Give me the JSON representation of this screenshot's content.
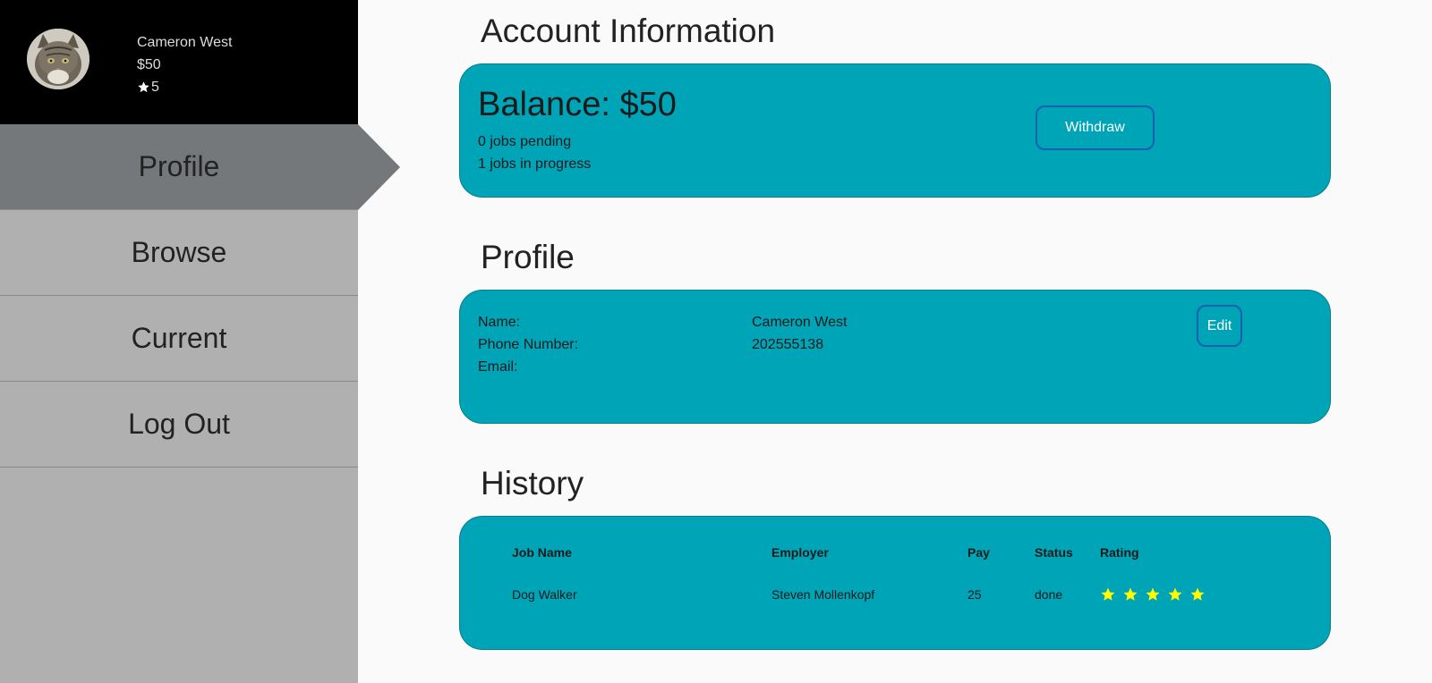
{
  "user": {
    "name": "Cameron West",
    "balance": "$50",
    "rating": "5"
  },
  "nav": {
    "items": [
      {
        "label": "Profile",
        "active": true
      },
      {
        "label": "Browse"
      },
      {
        "label": "Current"
      },
      {
        "label": "Log Out"
      }
    ]
  },
  "account": {
    "title": "Account Information",
    "balance_text": "Balance: $50",
    "jobs_pending": "0 jobs pending",
    "jobs_in_progress": "1 jobs in progress",
    "withdraw_label": "Withdraw"
  },
  "profile": {
    "title": "Profile",
    "name_label": "Name:",
    "name_value": "Cameron West",
    "phone_label": "Phone Number:",
    "phone_value": "202555138",
    "email_label": "Email:",
    "email_value": "",
    "edit_label": "Edit"
  },
  "history": {
    "title": "History",
    "columns": [
      "Job Name",
      "Employer",
      "Pay",
      "Status",
      "Rating"
    ],
    "rows": [
      {
        "job_name": "Dog Walker",
        "employer": "Steven Mollenkopf",
        "pay": "25",
        "status": "done",
        "rating": 5
      }
    ]
  },
  "colors": {
    "panel": "#00a4b7",
    "sidebar": "#b0b0b0",
    "nav_active": "#75787b",
    "star": "#ffff00",
    "button_border": "#1b5fae"
  }
}
